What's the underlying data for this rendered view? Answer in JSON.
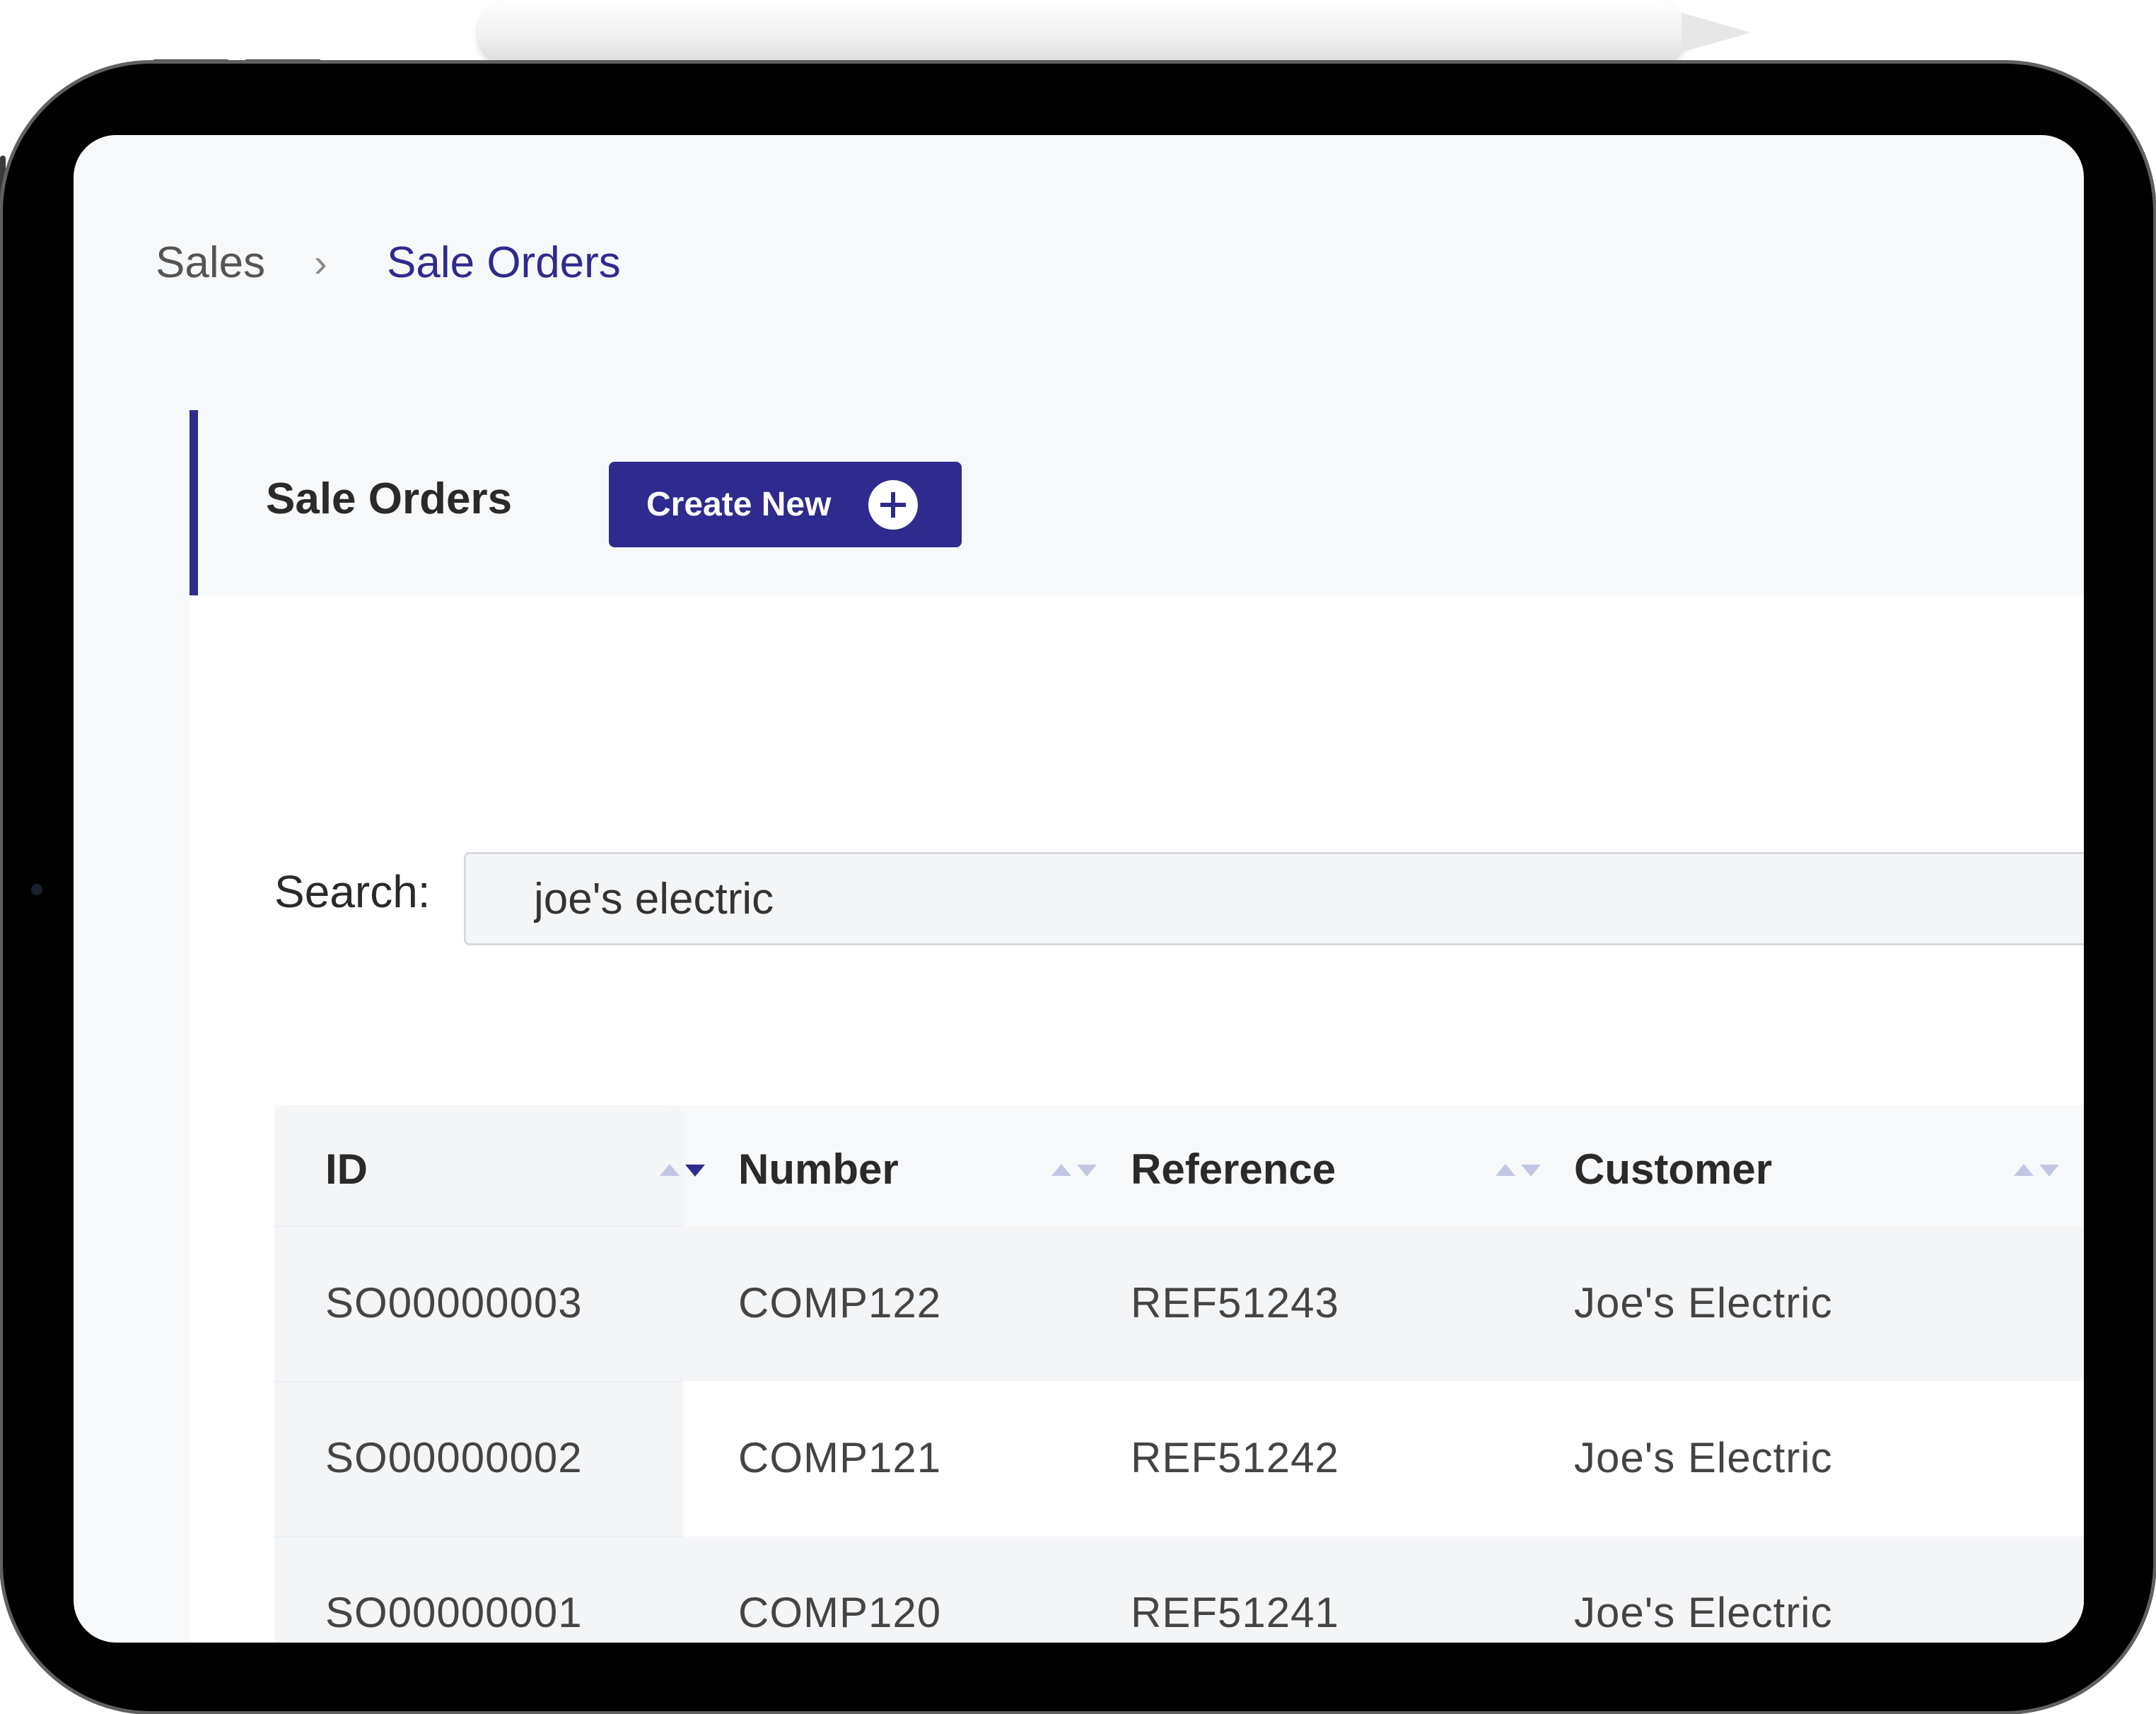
{
  "breadcrumb": {
    "parent": "Sales",
    "separator": "›",
    "current": "Sale Orders"
  },
  "card": {
    "title": "Sale Orders",
    "create_button_label": "Create New",
    "create_button_icon": "plus-circle-icon"
  },
  "search": {
    "label": "Search:",
    "value": "joe's electric"
  },
  "table": {
    "columns": [
      "ID",
      "Number",
      "Reference",
      "Customer"
    ],
    "sorted_column": "ID",
    "sort_direction": "descending",
    "rows": [
      [
        "SO00000003",
        "COMP122",
        "REF51243",
        "Joe's Electric"
      ],
      [
        "SO00000002",
        "COMP121",
        "REF51242",
        "Joe's Electric"
      ],
      [
        "SO00000001",
        "COMP120",
        "REF51241",
        "Joe's Electric"
      ]
    ]
  },
  "colors": {
    "accent": "#2f2a8e",
    "sort_inactive": "#c3c6e2",
    "background": "#f7f8fa"
  }
}
